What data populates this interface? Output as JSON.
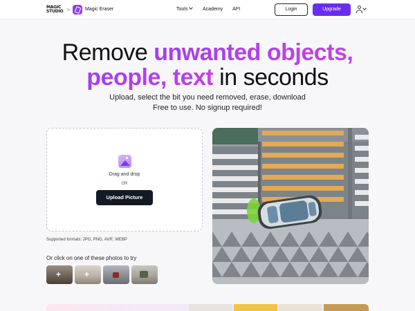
{
  "header": {
    "logo_line1": "MAGIC",
    "logo_line2": "STUDIO",
    "separator": ">",
    "product_name": "Magic Eraser",
    "nav": {
      "tools": "Tools",
      "academy": "Academy",
      "api": "API"
    },
    "login_label": "Login",
    "upgrade_label": "Upgrade"
  },
  "hero": {
    "title_grad1": "unwanted objects,",
    "title_pre": "Remove",
    "title_grad2": "people, text",
    "title_post": "in seconds",
    "subtitle_line1": "Upload, select the bit you need removed, erase, download",
    "subtitle_line2": "Free to use. No signup required!"
  },
  "upload": {
    "drag_text": "Drag and drop",
    "or_text": "OR",
    "button_label": "Upload Picture",
    "formats": "Supported formats: JPG, PNG, AVIF, WEBP",
    "try_text": "Or click on one of these photos to try"
  },
  "samples": [
    {
      "icon": "+"
    },
    {
      "icon": "+"
    },
    {
      "icon": ""
    },
    {
      "icon": ""
    }
  ],
  "colors": {
    "accent": "#6a2cf0",
    "gradient_text": "#a53df0",
    "dark_button": "#141a24"
  }
}
